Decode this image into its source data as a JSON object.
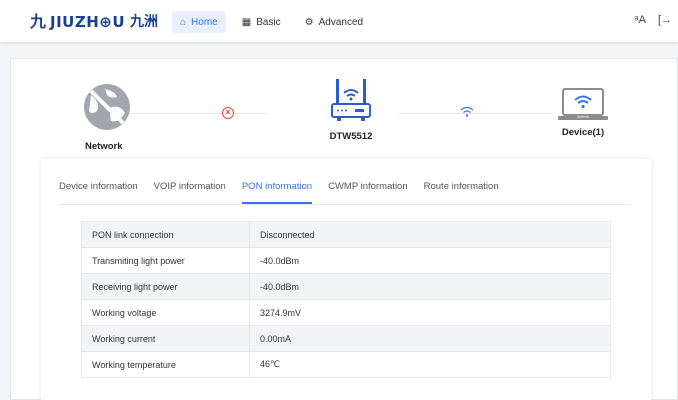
{
  "header": {
    "logo_mark": "九",
    "logo_text": "JIUZH⊕U",
    "logo_cn": "九洲",
    "nav": [
      {
        "label": "Home",
        "icon": "home-icon",
        "active": true
      },
      {
        "label": "Basic",
        "icon": "grid-icon",
        "active": false
      },
      {
        "label": "Advanced",
        "icon": "gear-icon",
        "active": false
      }
    ],
    "right_icons": [
      "translate-icon",
      "logout-icon"
    ]
  },
  "topology": {
    "network_label": "Network",
    "device_label": "DTW5512",
    "clients_label": "Device(1)",
    "link_status": "disconnected"
  },
  "tabs": [
    {
      "label": "Device information",
      "active": false
    },
    {
      "label": "VOIP information",
      "active": false
    },
    {
      "label": "PON information",
      "active": true
    },
    {
      "label": "CWMP information",
      "active": false
    },
    {
      "label": "Route information",
      "active": false
    }
  ],
  "pon_info": [
    {
      "key": "PON link connection",
      "value": "Disconnected"
    },
    {
      "key": "Transmiting light power",
      "value": "-40.0dBm"
    },
    {
      "key": "Receiving light power",
      "value": "-40.0dBm"
    },
    {
      "key": "Working voltage",
      "value": "3274.9mV"
    },
    {
      "key": "Working current",
      "value": "0.00mA"
    },
    {
      "key": "Working temperature",
      "value": "46℃"
    }
  ],
  "colors": {
    "accent": "#3a72e0",
    "brand": "#1a3f8f",
    "error": "#e04a3f"
  }
}
